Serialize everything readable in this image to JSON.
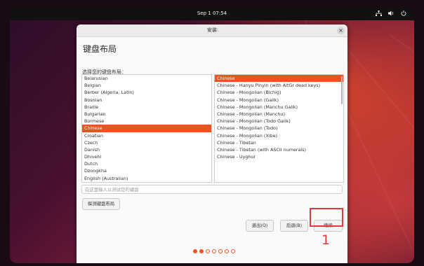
{
  "topbar": {
    "clock": "Sep 1  07:54",
    "icons": [
      "network-icon",
      "volume-icon",
      "power-icon"
    ]
  },
  "window": {
    "title": "安装",
    "heading": "键盘布局",
    "prompt": "选择您的键盘布局：",
    "layouts": [
      {
        "label": "Belarusian",
        "selected": false
      },
      {
        "label": "Belgian",
        "selected": false
      },
      {
        "label": "Berber (Algeria, Latin)",
        "selected": false
      },
      {
        "label": "Bosnian",
        "selected": false
      },
      {
        "label": "Braille",
        "selected": false
      },
      {
        "label": "Bulgarian",
        "selected": false
      },
      {
        "label": "Burmese",
        "selected": false
      },
      {
        "label": "Chinese",
        "selected": true
      },
      {
        "label": "Croatian",
        "selected": false
      },
      {
        "label": "Czech",
        "selected": false
      },
      {
        "label": "Danish",
        "selected": false
      },
      {
        "label": "Dhivehi",
        "selected": false
      },
      {
        "label": "Dutch",
        "selected": false
      },
      {
        "label": "Dzongkha",
        "selected": false
      },
      {
        "label": "English (Australian)",
        "selected": false
      }
    ],
    "variants": [
      {
        "label": "Chinese",
        "selected": true
      },
      {
        "label": "Chinese - Hanyu Pinyin (with AltGr dead keys)",
        "selected": false
      },
      {
        "label": "Chinese - Mongolian (Bichig)",
        "selected": false
      },
      {
        "label": "Chinese - Mongolian (Galik)",
        "selected": false
      },
      {
        "label": "Chinese - Mongolian (Manchu Galik)",
        "selected": false
      },
      {
        "label": "Chinese - Mongolian (Manchu)",
        "selected": false
      },
      {
        "label": "Chinese - Mongolian (Todo Galik)",
        "selected": false
      },
      {
        "label": "Chinese - Mongolian (Todo)",
        "selected": false
      },
      {
        "label": "Chinese - Mongolian (Xibe)",
        "selected": false
      },
      {
        "label": "Chinese - Tibetan",
        "selected": false
      },
      {
        "label": "Chinese - Tibetan (with ASCII numerals)",
        "selected": false
      },
      {
        "label": "Chinese - Uyghur",
        "selected": false
      }
    ],
    "test_placeholder": "在这里输入以测试您的键盘",
    "detect_label": "探测键盘布局",
    "quit_label": "退出(Q)",
    "back_label": "后退(B)",
    "continue_label": "继续",
    "progress": {
      "total": 7,
      "completed": 2
    }
  },
  "annotation": {
    "marker": "1",
    "color": "#e03a3a"
  },
  "colors": {
    "accent": "#e95420"
  }
}
